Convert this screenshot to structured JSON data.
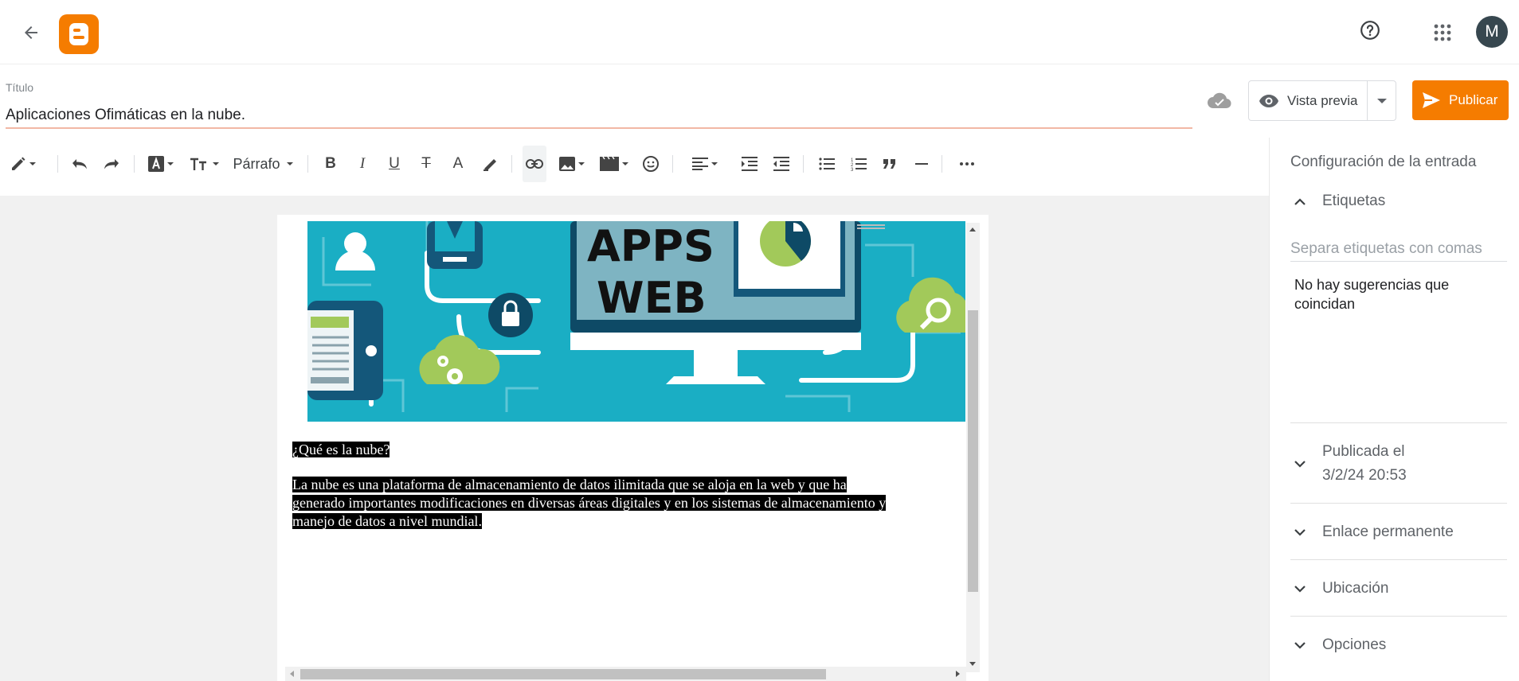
{
  "header": {
    "back_icon": "arrow-left-icon",
    "logo": "blogger-logo",
    "brand_color": "#f57c00",
    "help_icon": "help-circle-icon",
    "apps_icon": "apps-grid-icon",
    "avatar_initial": "M",
    "avatar_color": "#37474f"
  },
  "title": {
    "label": "Título",
    "value": "Aplicaciones Ofimáticas en la nube."
  },
  "actions": {
    "save_icon": "cloud-check-icon",
    "preview_label": "Vista previa",
    "publish_label": "Publicar"
  },
  "toolbar": {
    "paragraph_label": "Párrafo",
    "icons": [
      "pencil-icon",
      "undo-icon",
      "redo-icon",
      "font-color-icon",
      "text-size-icon",
      "bold-icon",
      "italic-icon",
      "underline-icon",
      "strikethrough-icon",
      "text-color-icon",
      "highlight-icon",
      "link-icon",
      "image-icon",
      "video-icon",
      "emoji-icon",
      "align-left-icon",
      "indent-icon",
      "outdent-icon",
      "bullet-list-icon",
      "numbered-list-icon",
      "quote-icon",
      "horizontal-rule-icon",
      "more-icon"
    ]
  },
  "content": {
    "hero_text_line1": "APPS",
    "hero_text_line2": "WEB",
    "heading": "¿Qué es la nube?",
    "paragraph_line1": "La nube es una plataforma de almacenamiento de datos ilimitada que se aloja en la web y que ha",
    "paragraph_line2": "generado importantes modificaciones en diversas áreas digitales y en los sistemas de almacenamiento y",
    "paragraph_line3": "manejo de datos a nivel mundial."
  },
  "sidebar": {
    "title": "Configuración de la entrada",
    "labels_section": "Etiquetas",
    "labels_placeholder": "Separa etiquetas con comas",
    "no_suggestions": "No hay sugerencias que coincidan",
    "published_label": "Publicada el",
    "published_date": "3/2/24 20:53",
    "permalink_label": "Enlace permanente",
    "location_label": "Ubicación",
    "options_label": "Opciones"
  }
}
